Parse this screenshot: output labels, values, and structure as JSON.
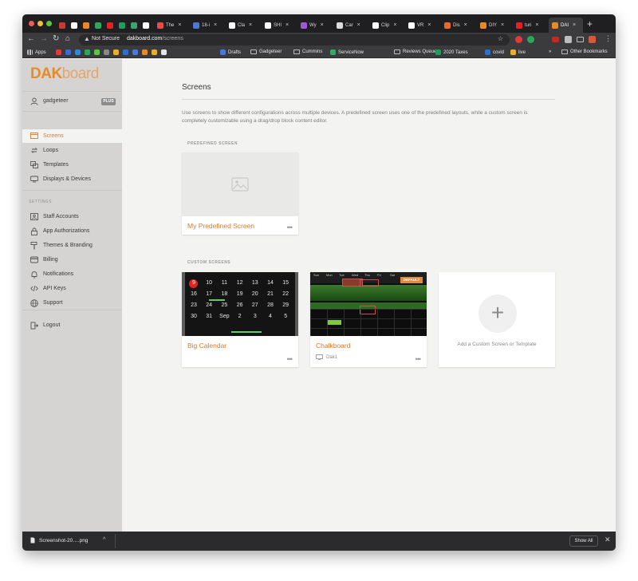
{
  "browser": {
    "tabs": [
      {
        "label": "The",
        "color": "#e54b4b",
        "active": false
      },
      {
        "label": "18-i",
        "color": "#4a78d6",
        "active": false
      },
      {
        "label": "Cla",
        "color": "#ffffff",
        "active": false
      },
      {
        "label": "SHI",
        "color": "#ffffff",
        "active": false
      },
      {
        "label": "Wy",
        "color": "#a056d6",
        "active": false
      },
      {
        "label": "Car",
        "color": "#dddddd",
        "active": false
      },
      {
        "label": "Clip",
        "color": "#ffffff",
        "active": false
      },
      {
        "label": "VR",
        "color": "#ffffff",
        "active": false
      },
      {
        "label": "Dis",
        "color": "#e96a2a",
        "active": false
      },
      {
        "label": "DIY",
        "color": "#e98a28",
        "active": false
      },
      {
        "label": "turi",
        "color": "#e02424",
        "active": false
      },
      {
        "label": "DAI",
        "color": "#e98a28",
        "active": true
      }
    ],
    "security_label": "Not Secure",
    "url_host": "dakboard.com",
    "url_path": "/screens",
    "new_tab_glyph": "+",
    "bookmarks": [
      {
        "label": "Apps",
        "type": "apps"
      },
      {
        "label": "Drafts",
        "type": "icon",
        "color": "#4a78d6"
      },
      {
        "label": "Gadgeteer",
        "type": "folder"
      },
      {
        "label": "Cummins",
        "type": "folder"
      },
      {
        "label": "ServiceNow",
        "type": "icon",
        "color": "#3aa56a"
      },
      {
        "label": "Reviews Queues",
        "type": "folder"
      },
      {
        "label": "2020 Taxes",
        "type": "icon",
        "color": "#1e9e5a"
      },
      {
        "label": "covid",
        "type": "icon",
        "color": "#2b6fd1"
      },
      {
        "label": "live",
        "type": "icon",
        "color": "#e9b028"
      }
    ],
    "more_bookmarks_glyph": "»",
    "other_bookmarks": "Other Bookmarks"
  },
  "sidebar": {
    "logo_a": "DAK",
    "logo_b": "board",
    "username": "gadgeteer",
    "plan_badge": "PLUS",
    "items": [
      {
        "label": "Screens",
        "icon": "screens-icon",
        "active": true
      },
      {
        "label": "Loops",
        "icon": "loop-icon",
        "active": false
      },
      {
        "label": "Templates",
        "icon": "templates-icon",
        "active": false
      },
      {
        "label": "Displays & Devices",
        "icon": "display-icon",
        "active": false
      }
    ],
    "settings_label": "SETTINGS",
    "settings_items": [
      {
        "label": "Staff Accounts",
        "icon": "staff-icon"
      },
      {
        "label": "App Authorizations",
        "icon": "lock-icon"
      },
      {
        "label": "Themes & Branding",
        "icon": "brush-icon"
      },
      {
        "label": "Billing",
        "icon": "credit-card-icon"
      },
      {
        "label": "Notifications",
        "icon": "bell-icon"
      },
      {
        "label": "API Keys",
        "icon": "code-icon"
      },
      {
        "label": "Support",
        "icon": "globe-icon"
      }
    ],
    "logout_label": "Logout"
  },
  "main": {
    "title": "Screens",
    "intro": "Use screens to show different configurations across multiple devices. A predefined screen uses one of the predefined layouts, while a custom screen is completely customizable using a drag/drop block content editor.",
    "predefined_heading": "PREDEFINED SCREEN",
    "predefined_screens": [
      {
        "name": "My Predefined Screen",
        "menu": "•••"
      }
    ],
    "custom_heading": "CUSTOM SCREENS",
    "custom_screens": [
      {
        "name": "Big Calendar",
        "menu": "•••",
        "device": ""
      },
      {
        "name": "Chalkboard",
        "menu": "•••",
        "device": "Dak1"
      }
    ],
    "add_glyph": "+",
    "add_label": "Add a Custom Screen or Template"
  },
  "big_calendar_thumb": {
    "rows": [
      [
        "9",
        "10",
        "11",
        "12",
        "13",
        "14",
        "15"
      ],
      [
        "16",
        "17",
        "18",
        "19",
        "20",
        "21",
        "22"
      ],
      [
        "23",
        "24",
        "25",
        "26",
        "27",
        "28",
        "29"
      ],
      [
        "30",
        "31",
        "Sep",
        "2",
        "3",
        "4",
        "5"
      ]
    ]
  },
  "chalkboard_thumb": {
    "days": [
      "Sun",
      "Mon",
      "Tue",
      "Wed",
      "Thu",
      "Fri",
      "Sat"
    ],
    "badge": "DEFAULT"
  },
  "download_bar": {
    "filename": "Screenshot-20….png",
    "chevron": "^",
    "show_all": "Show All",
    "close": "✕"
  }
}
